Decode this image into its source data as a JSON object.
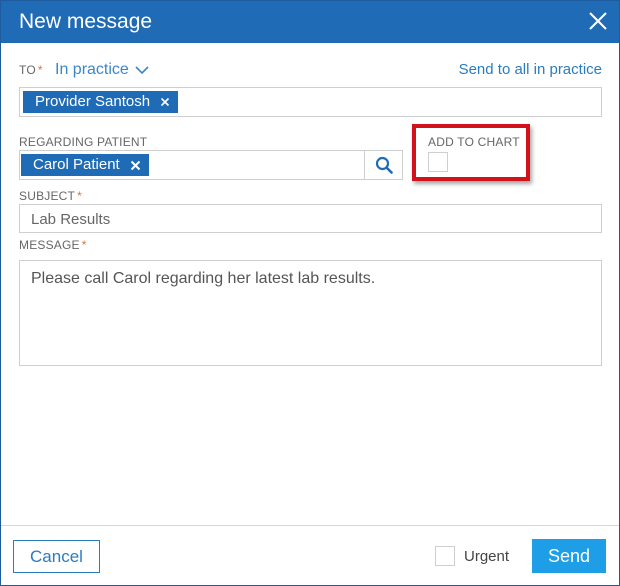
{
  "dialog": {
    "title": "New message"
  },
  "to": {
    "label": "TO",
    "required_mark": "*",
    "scope_value": "In practice",
    "send_all_link": "Send to all in practice",
    "recipients": [
      {
        "name": "Provider Santosh"
      }
    ]
  },
  "regarding_patient": {
    "label": "REGARDING PATIENT",
    "patients": [
      {
        "name": "Carol Patient"
      }
    ]
  },
  "add_to_chart": {
    "label": "ADD TO CHART",
    "checked": false
  },
  "subject": {
    "label": "SUBJECT",
    "required_mark": "*",
    "value": "Lab Results"
  },
  "message": {
    "label": "MESSAGE",
    "required_mark": "*",
    "value": "Please call Carol regarding her latest lab results."
  },
  "footer": {
    "cancel_label": "Cancel",
    "urgent_label": "Urgent",
    "urgent_checked": false,
    "send_label": "Send"
  },
  "colors": {
    "titlebar": "#1f6bb5",
    "chip": "#1f6bb5",
    "link": "#2a7cc0",
    "send_button": "#1e9ee6",
    "highlight_border": "#d2121b",
    "required_mark": "#e0703a"
  }
}
